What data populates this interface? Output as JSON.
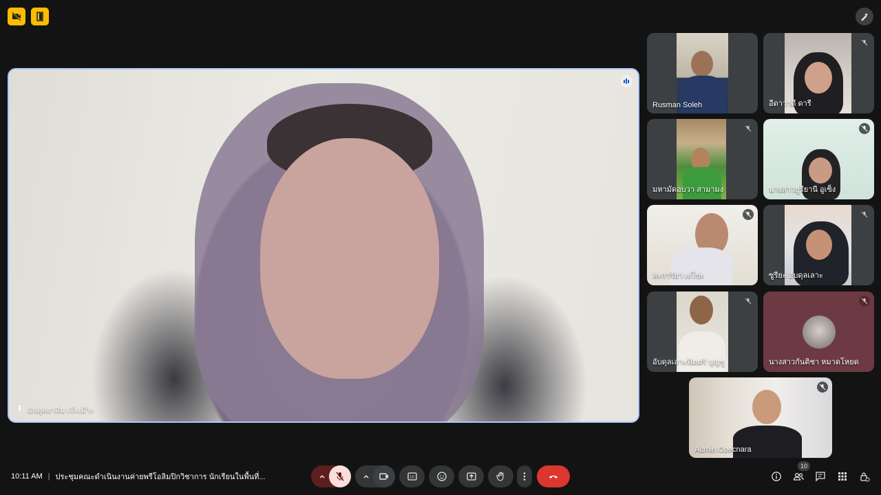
{
  "colors": {
    "background": "#131314",
    "accent": "#a8c7fa",
    "warning": "#fbbc04",
    "end_call": "#ea4335",
    "mic_off": "#f9dedc"
  },
  "toolbar_top": {
    "left_icons": [
      "camera-off-icon",
      "door-exit-icon"
    ],
    "right_icon": "pen-effects-icon"
  },
  "main_stage": {
    "speaker_name": "อับดุลฮาลีม เจ๊ะเม๊าะ",
    "pin_icon": "pin-icon",
    "speaking_icon": "speaking-icon"
  },
  "participants": [
    {
      "name": "Rusman Soleh",
      "muted": false
    },
    {
      "name": "อีดาวาดี ดารี",
      "muted": true
    },
    {
      "name": "มหามัดอบวา สามามง",
      "muted": true
    },
    {
      "name": "นางสาวฮูรียานี อูเซ็ง",
      "muted": true
    },
    {
      "name": "สะการียา เงโซะ",
      "muted": true
    },
    {
      "name": "ซูรียะ อับดุลเลาะ",
      "muted": true
    },
    {
      "name": "อับดุลเลาะฟิตตรี บุญชู",
      "muted": true
    },
    {
      "name": "นางสาวกันติชา หมาดโหยด",
      "muted": true
    },
    {
      "name": "Admin Opecnara",
      "muted": true
    }
  ],
  "bottom_bar": {
    "time": "10:11 AM",
    "meeting_title": "ประชุมคณะดำเนินงานค่ายพรีโอลิมปิกวิชาการ นักเรียนในพื้นที่...",
    "controls": [
      "chevron-up-icon",
      "mic-off-icon",
      "chevron-up-icon",
      "camera-icon",
      "captions-icon",
      "emoji-icon",
      "present-icon",
      "raise-hand-icon",
      "more-options-icon",
      "end-call-icon"
    ],
    "right_icons": [
      "info-icon",
      "people-icon",
      "chat-icon",
      "activities-icon",
      "host-controls-icon"
    ],
    "people_count": "10"
  }
}
